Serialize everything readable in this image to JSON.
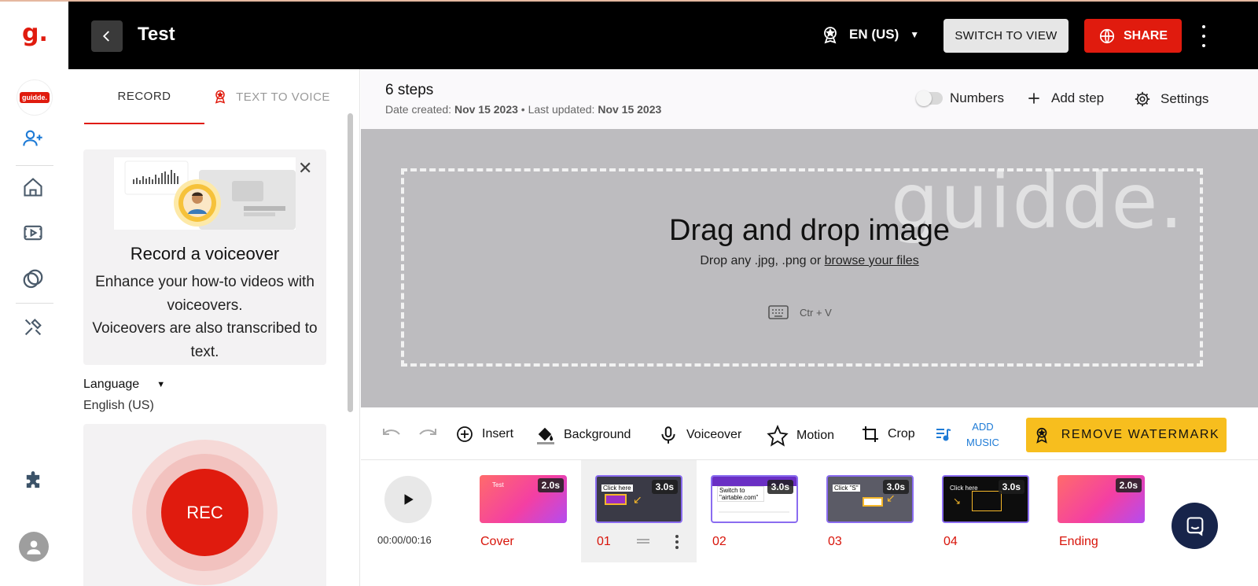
{
  "app": {
    "logo": "g.",
    "badge": "guidde.",
    "title": "Test"
  },
  "topbar": {
    "language": "EN (US)",
    "switch_label": "SWITCH TO VIEW",
    "share_label": "SHARE"
  },
  "panel": {
    "tabs": [
      "RECORD",
      "TEXT TO VOICE"
    ],
    "card": {
      "title": "Record a voiceover",
      "body_line1": "Enhance your how-to videos with voiceovers.",
      "body_line2": "Voiceovers are also transcribed to text."
    },
    "language_label": "Language",
    "language_value": "English (US)",
    "rec_label": "REC"
  },
  "main": {
    "steps": "6 steps",
    "date_created_label": "Date created:",
    "date_created": "Nov 15 2023",
    "sep": "•",
    "last_updated_label": "Last updated:",
    "last_updated": "Nov 15 2023",
    "numbers_label": "Numbers",
    "add_step_label": "Add step",
    "settings_label": "Settings"
  },
  "canvas": {
    "watermark": "guidde.",
    "drop_title": "Drag and drop image",
    "drop_sub_prefix": "Drop any .jpg, .png or",
    "drop_sub_link": "browse your files",
    "paste_hint": "Ctr + V"
  },
  "toolbar": {
    "insert": "Insert",
    "background": "Background",
    "voiceover": "Voiceover",
    "motion": "Motion",
    "crop": "Crop",
    "add_music_line1": "ADD",
    "add_music_line2": "MUSIC",
    "remove_watermark": "REMOVE WATERMARK"
  },
  "timeline": {
    "time": "00:00/00:16",
    "steps": [
      {
        "label": "Cover",
        "duration": "2.0s",
        "mini": "Test"
      },
      {
        "label": "01",
        "duration": "3.0s",
        "mini": "Click here"
      },
      {
        "label": "02",
        "duration": "3.0s",
        "mini": "Switch to \"airtable.com\""
      },
      {
        "label": "03",
        "duration": "3.0s",
        "mini": "Click \"S\""
      },
      {
        "label": "04",
        "duration": "3.0s",
        "mini": "Click here"
      },
      {
        "label": "Ending",
        "duration": "2.0s",
        "mini": ""
      }
    ]
  },
  "colors": {
    "brand_red": "#e01b0e",
    "accent_yellow": "#f7be1e",
    "topbar_bg": "#000000",
    "canvas_bg": "#bdbcbf"
  }
}
